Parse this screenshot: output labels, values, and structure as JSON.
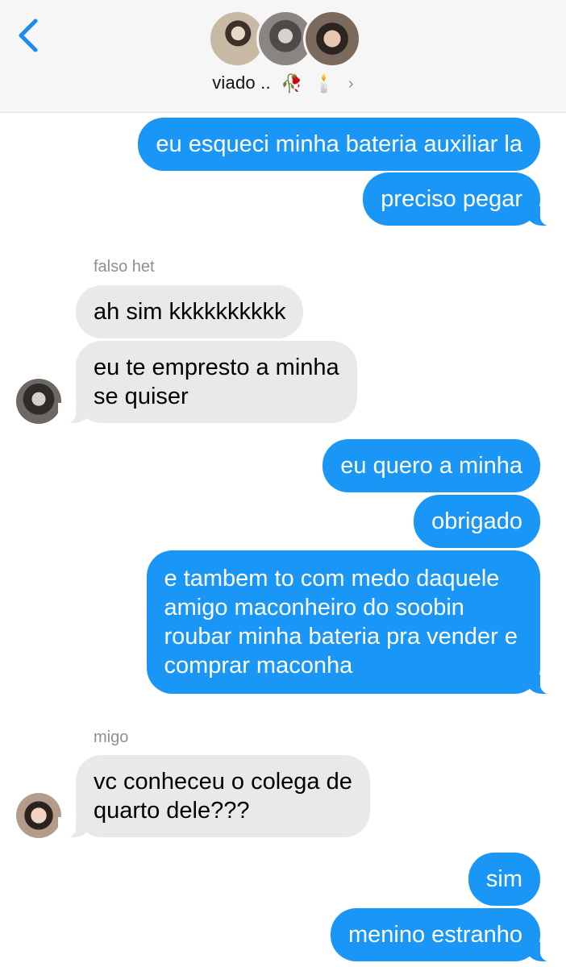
{
  "header": {
    "group_name": "viado ..",
    "emoji_1": "🥀",
    "emoji_2": "🕯️",
    "chevron": "›",
    "back_icon": "chevron-left-icon",
    "accent_color": "#1a96f7"
  },
  "conversation": [
    {
      "type": "outgoing",
      "text": "eu esqueci minha bateria auxiliar la"
    },
    {
      "type": "outgoing",
      "text": "preciso pegar"
    },
    {
      "type": "sender_label",
      "text": "falso het"
    },
    {
      "type": "incoming",
      "text": "ah sim kkkkkkkkkk"
    },
    {
      "type": "incoming",
      "lines": [
        "eu te empresto a minha",
        "se quiser"
      ]
    },
    {
      "type": "outgoing",
      "text": "eu quero a minha"
    },
    {
      "type": "outgoing",
      "text": "obrigado"
    },
    {
      "type": "outgoing",
      "lines": [
        "e tambem to com medo daquele",
        "amigo maconheiro do soobin",
        "roubar minha bateria pra vender e",
        "comprar maconha"
      ]
    },
    {
      "type": "sender_label",
      "text": "migo"
    },
    {
      "type": "incoming",
      "lines": [
        "vc conheceu o colega de",
        "quarto dele???"
      ]
    },
    {
      "type": "outgoing",
      "text": "sim"
    },
    {
      "type": "outgoing",
      "text": "menino estranho"
    }
  ],
  "colors": {
    "outgoing_bubble": "#1a96f7",
    "incoming_bubble": "#e9e9eb",
    "header_bg": "#f6f6f6",
    "sender_label": "#8e8e93"
  }
}
